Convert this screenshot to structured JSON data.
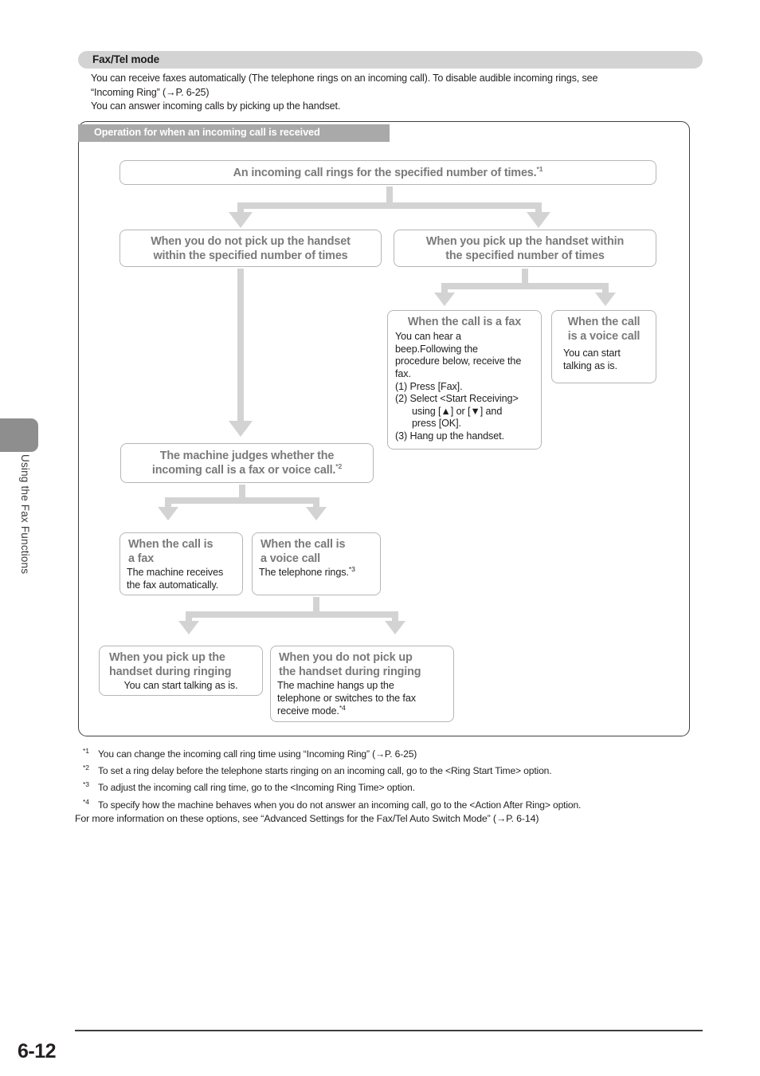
{
  "sidebar": {
    "chapter_label": "Using the Fax Functions"
  },
  "section": {
    "header": "Fax/Tel mode",
    "intro_line1": "You can receive faxes automatically (The telephone rings on an incoming call). To disable audible incoming rings, see",
    "intro_line2": "“Incoming Ring” (→P. 6-25)",
    "intro_line3": "You can answer incoming calls by picking up the handset."
  },
  "flowchart": {
    "title": "Operation for when an incoming call is received",
    "start_box": {
      "text": "An incoming call rings for the specified number of times.",
      "footnote": "*1"
    },
    "branch_left": {
      "line1": "When you do not pick up the handset",
      "line2": "within the specified number of times"
    },
    "branch_right": {
      "line1": "When you pick up the handset within",
      "line2": "the specified number of times"
    },
    "pickup_fax": {
      "title": "When the call is a fax",
      "body_line1": "You can hear a",
      "body_line2": "beep.Following the",
      "body_line3": "procedure below, receive the",
      "body_line4": "fax.",
      "step1": "(1) Press [Fax].",
      "step2a": "(2) Select <Start Receiving>",
      "step2b": "using [▲] or [▼] and",
      "step2c": "press [OK].",
      "step3": "(3) Hang up the handset."
    },
    "pickup_voice": {
      "title_line1": "When the call",
      "title_line2": "is a voice call",
      "body_line1": "You can start",
      "body_line2": "talking as is."
    },
    "judge_box": {
      "line1": "The machine judges whether the",
      "line2": "incoming call is a fax or voice call.",
      "footnote": "*2"
    },
    "judge_fax": {
      "title_line1": "When the call is",
      "title_line2": "a fax",
      "body_line1": "The machine receives",
      "body_line2": "the fax automatically."
    },
    "judge_voice": {
      "title_line1": "When the call is",
      "title_line2": "a voice call",
      "body": "The telephone rings.",
      "footnote": "*3"
    },
    "ring_pickup": {
      "title_line1": "When you pick up the",
      "title_line2": "handset during ringing",
      "body": "You can start talking as is."
    },
    "ring_nopickup": {
      "title_line1": "When you do not pick up",
      "title_line2": "the handset during ringing",
      "body_line1": "The machine hangs up the",
      "body_line2": "telephone or switches to the fax",
      "body_line3": "receive mode.",
      "footnote": "*4"
    }
  },
  "footnotes": [
    {
      "mark": "*1",
      "text": "You can change the incoming call ring time using “Incoming Ring” (→P. 6-25)"
    },
    {
      "mark": "*2",
      "text": "To set a ring delay before the telephone starts ringing on an incoming call, go to the <Ring Start Time> option."
    },
    {
      "mark": "*3",
      "text": "To adjust the incoming call ring time, go to the <Incoming Ring Time> option."
    },
    {
      "mark": "*4",
      "text": "To specify how the machine behaves when you do not answer an incoming call, go to the <Action After Ring> option."
    }
  ],
  "more_info": "For more information on these options, see “Advanced Settings for the Fax/Tel Auto Switch Mode” (→P. 6-14)",
  "footer": {
    "page_number": "6-12"
  },
  "colors": {
    "header_bar": "#d3d3d3",
    "flow_title_bar": "#a9a9a9",
    "arrow": "#d3d3d3",
    "box_border": "#b6b6b6",
    "title_text": "#7a7a7a",
    "sidetab": "#8e8e8e"
  }
}
